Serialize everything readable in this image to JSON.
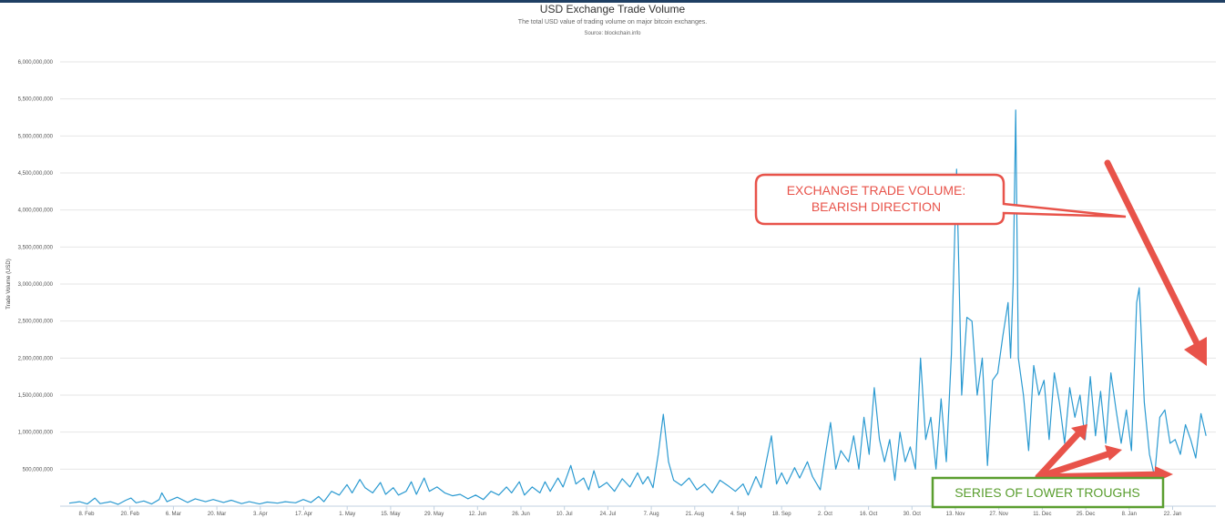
{
  "chart_data": {
    "type": "line",
    "title": "USD Exchange Trade Volume",
    "subtitle": "The total USD value of trading volume on major bitcoin exchanges.",
    "source": "Source: blockchain.info",
    "ylabel": "Trade Volume (USD)",
    "ylim": [
      0,
      6000000000
    ],
    "y_ticks": [
      "500,000,000",
      "1,000,000,000",
      "1,500,000,000",
      "2,000,000,000",
      "2,500,000,000",
      "3,000,000,000",
      "3,500,000,000",
      "4,000,000,000",
      "4,500,000,000",
      "5,000,000,000",
      "5,500,000,000",
      "6,000,000,000"
    ],
    "x_ticks": [
      "8. Feb",
      "20. Feb",
      "6. Mar",
      "20. Mar",
      "3. Apr",
      "17. Apr",
      "1. May",
      "15. May",
      "29. May",
      "12. Jun",
      "26. Jun",
      "10. Jul",
      "24. Jul",
      "7. Aug",
      "21. Aug",
      "4. Sep",
      "18. Sep",
      "2. Oct",
      "16. Oct",
      "30. Oct",
      "13. Nov",
      "27. Nov",
      "11. Dec",
      "25. Dec",
      "8. Jan",
      "22. Jan"
    ],
    "grid": true,
    "line_color": "#2b9ad1",
    "series": [
      {
        "values": [
          [
            0,
            40000000
          ],
          [
            4,
            60000000
          ],
          [
            7,
            30000000
          ],
          [
            10,
            110000000
          ],
          [
            12,
            35000000
          ],
          [
            16,
            60000000
          ],
          [
            19,
            25000000
          ],
          [
            22,
            80000000
          ],
          [
            24,
            110000000
          ],
          [
            26,
            45000000
          ],
          [
            29,
            70000000
          ],
          [
            32,
            30000000
          ],
          [
            35,
            90000000
          ],
          [
            36,
            180000000
          ],
          [
            38,
            60000000
          ],
          [
            42,
            120000000
          ],
          [
            46,
            50000000
          ],
          [
            49,
            100000000
          ],
          [
            53,
            60000000
          ],
          [
            56,
            90000000
          ],
          [
            60,
            50000000
          ],
          [
            63,
            80000000
          ],
          [
            67,
            35000000
          ],
          [
            70,
            60000000
          ],
          [
            74,
            30000000
          ],
          [
            77,
            55000000
          ],
          [
            81,
            40000000
          ],
          [
            84,
            60000000
          ],
          [
            88,
            45000000
          ],
          [
            91,
            90000000
          ],
          [
            94,
            50000000
          ],
          [
            97,
            130000000
          ],
          [
            99,
            60000000
          ],
          [
            102,
            200000000
          ],
          [
            105,
            150000000
          ],
          [
            108,
            290000000
          ],
          [
            110,
            180000000
          ],
          [
            113,
            360000000
          ],
          [
            115,
            250000000
          ],
          [
            118,
            180000000
          ],
          [
            121,
            320000000
          ],
          [
            123,
            160000000
          ],
          [
            126,
            250000000
          ],
          [
            128,
            150000000
          ],
          [
            131,
            200000000
          ],
          [
            133,
            330000000
          ],
          [
            135,
            160000000
          ],
          [
            138,
            380000000
          ],
          [
            140,
            200000000
          ],
          [
            143,
            260000000
          ],
          [
            146,
            180000000
          ],
          [
            149,
            140000000
          ],
          [
            152,
            160000000
          ],
          [
            155,
            100000000
          ],
          [
            158,
            150000000
          ],
          [
            161,
            90000000
          ],
          [
            164,
            200000000
          ],
          [
            167,
            150000000
          ],
          [
            170,
            260000000
          ],
          [
            172,
            180000000
          ],
          [
            175,
            330000000
          ],
          [
            177,
            150000000
          ],
          [
            180,
            260000000
          ],
          [
            183,
            180000000
          ],
          [
            185,
            330000000
          ],
          [
            187,
            200000000
          ],
          [
            190,
            380000000
          ],
          [
            192,
            260000000
          ],
          [
            195,
            550000000
          ],
          [
            197,
            300000000
          ],
          [
            200,
            380000000
          ],
          [
            202,
            220000000
          ],
          [
            204,
            480000000
          ],
          [
            206,
            250000000
          ],
          [
            209,
            320000000
          ],
          [
            212,
            200000000
          ],
          [
            215,
            370000000
          ],
          [
            218,
            260000000
          ],
          [
            221,
            450000000
          ],
          [
            223,
            300000000
          ],
          [
            225,
            400000000
          ],
          [
            227,
            250000000
          ],
          [
            229,
            700000000
          ],
          [
            231,
            1240000000
          ],
          [
            233,
            600000000
          ],
          [
            235,
            350000000
          ],
          [
            238,
            280000000
          ],
          [
            241,
            380000000
          ],
          [
            244,
            220000000
          ],
          [
            247,
            300000000
          ],
          [
            250,
            180000000
          ],
          [
            253,
            350000000
          ],
          [
            256,
            280000000
          ],
          [
            259,
            200000000
          ],
          [
            262,
            300000000
          ],
          [
            264,
            150000000
          ],
          [
            267,
            400000000
          ],
          [
            269,
            250000000
          ],
          [
            271,
            600000000
          ],
          [
            273,
            950000000
          ],
          [
            275,
            300000000
          ],
          [
            277,
            450000000
          ],
          [
            279,
            300000000
          ],
          [
            282,
            520000000
          ],
          [
            284,
            380000000
          ],
          [
            287,
            600000000
          ],
          [
            289,
            400000000
          ],
          [
            292,
            220000000
          ],
          [
            294,
            700000000
          ],
          [
            296,
            1130000000
          ],
          [
            298,
            500000000
          ],
          [
            300,
            750000000
          ],
          [
            303,
            600000000
          ],
          [
            305,
            950000000
          ],
          [
            307,
            500000000
          ],
          [
            309,
            1200000000
          ],
          [
            311,
            700000000
          ],
          [
            313,
            1600000000
          ],
          [
            315,
            900000000
          ],
          [
            317,
            600000000
          ],
          [
            319,
            900000000
          ],
          [
            321,
            350000000
          ],
          [
            323,
            1000000000
          ],
          [
            325,
            600000000
          ],
          [
            327,
            800000000
          ],
          [
            329,
            500000000
          ],
          [
            331,
            2000000000
          ],
          [
            333,
            900000000
          ],
          [
            335,
            1200000000
          ],
          [
            337,
            500000000
          ],
          [
            339,
            1450000000
          ],
          [
            341,
            600000000
          ],
          [
            343,
            2050000000
          ],
          [
            345,
            4550000000
          ],
          [
            347,
            1500000000
          ],
          [
            349,
            2550000000
          ],
          [
            351,
            2500000000
          ],
          [
            353,
            1500000000
          ],
          [
            355,
            2000000000
          ],
          [
            357,
            550000000
          ],
          [
            359,
            1700000000
          ],
          [
            361,
            1800000000
          ],
          [
            363,
            2300000000
          ],
          [
            365,
            2750000000
          ],
          [
            366,
            2000000000
          ],
          [
            367,
            3000000000
          ],
          [
            368,
            5350000000
          ],
          [
            369,
            2000000000
          ],
          [
            371,
            1500000000
          ],
          [
            373,
            750000000
          ],
          [
            375,
            1900000000
          ],
          [
            377,
            1500000000
          ],
          [
            379,
            1700000000
          ],
          [
            381,
            900000000
          ],
          [
            383,
            1800000000
          ],
          [
            385,
            1400000000
          ],
          [
            387,
            850000000
          ],
          [
            389,
            1600000000
          ],
          [
            391,
            1200000000
          ],
          [
            393,
            1500000000
          ],
          [
            395,
            900000000
          ],
          [
            397,
            1750000000
          ],
          [
            399,
            950000000
          ],
          [
            401,
            1550000000
          ],
          [
            403,
            850000000
          ],
          [
            405,
            1800000000
          ],
          [
            407,
            1300000000
          ],
          [
            409,
            850000000
          ],
          [
            411,
            1300000000
          ],
          [
            413,
            750000000
          ],
          [
            415,
            2750000000
          ],
          [
            416,
            2950000000
          ],
          [
            418,
            1400000000
          ],
          [
            420,
            700000000
          ],
          [
            422,
            400000000
          ],
          [
            424,
            1200000000
          ],
          [
            426,
            1300000000
          ],
          [
            428,
            850000000
          ],
          [
            430,
            900000000
          ],
          [
            432,
            700000000
          ],
          [
            434,
            1100000000
          ],
          [
            436,
            900000000
          ],
          [
            438,
            650000000
          ],
          [
            440,
            1250000000
          ],
          [
            442,
            950000000
          ]
        ]
      }
    ]
  },
  "annotations": {
    "bubble_line1": "EXCHANGE TRADE VOLUME:",
    "bubble_line2": "BEARISH DIRECTION",
    "box_text": "SERIES OF LOWER TROUGHS"
  }
}
